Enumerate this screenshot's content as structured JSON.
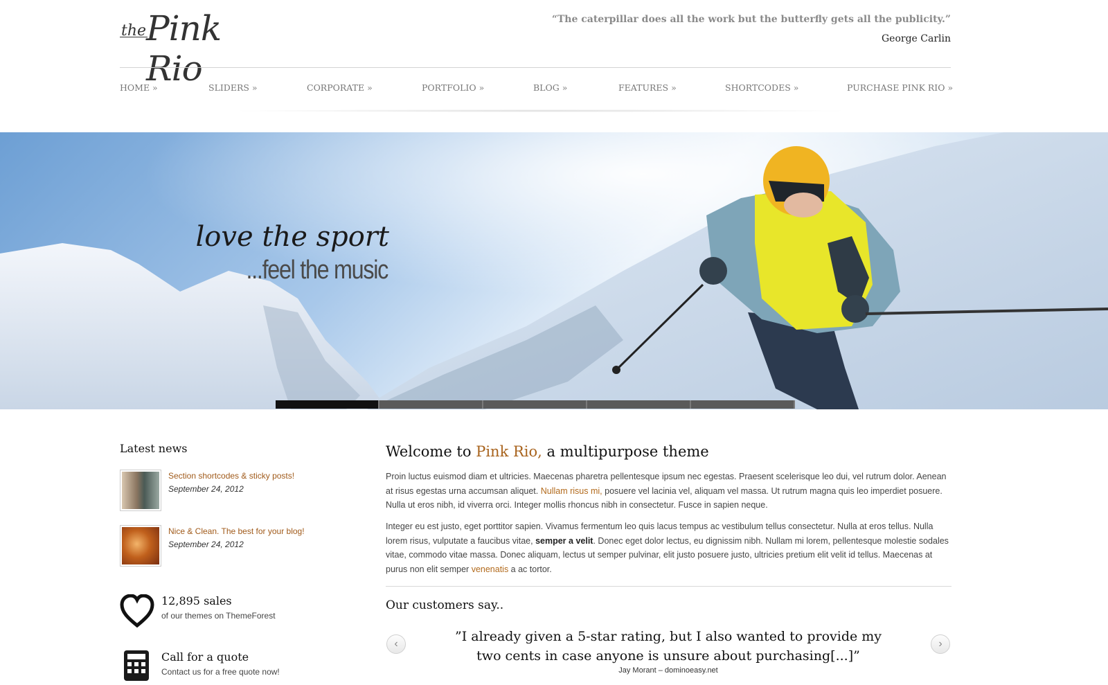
{
  "header": {
    "logo": {
      "prefix": "the",
      "name": "Pink Rio"
    },
    "quote": "“The caterpillar does all the work but the butterfly gets all the publicity.”",
    "quote_author": "George Carlin"
  },
  "nav": {
    "items": [
      {
        "label": "HOME »"
      },
      {
        "label": "SLIDERS »"
      },
      {
        "label": "CORPORATE »"
      },
      {
        "label": "PORTFOLIO »"
      },
      {
        "label": "BLOG »"
      },
      {
        "label": "FEATURES »"
      },
      {
        "label": "SHORTCODES »"
      },
      {
        "label": "PURCHASE PINK RIO »"
      }
    ]
  },
  "slider": {
    "title": "love the sport",
    "subtitle": "...feel the music",
    "slide_count": 5,
    "active_slide": 1
  },
  "latest_news": {
    "heading": "Latest news",
    "items": [
      {
        "title": "Section shortcodes & sticky posts!",
        "date": "September 24, 2012"
      },
      {
        "title": "Nice & Clean. The best for your blog!",
        "date": "September 24, 2012"
      }
    ]
  },
  "stats": [
    {
      "icon": "heart-icon",
      "title": "12,895 sales",
      "subtitle": "of our themes on ThemeForest"
    },
    {
      "icon": "calculator-icon",
      "title": "Call for a quote",
      "subtitle": "Contact us for a free quote now!"
    }
  ],
  "welcome": {
    "prefix": "Welcome to ",
    "accent": "Pink Rio,",
    "suffix": " a multipurpose theme",
    "p1_a": "Proin luctus euismod diam et ultricies. Maecenas pharetra pellentesque ipsum nec egestas. Praesent scelerisque leo dui, vel rutrum dolor. Aenean at risus egestas urna accumsan aliquet. ",
    "p1_link": "Nullam risus mi,",
    "p1_b": " posuere vel lacinia vel, aliquam vel massa. Ut rutrum magna quis leo imperdiet posuere. Nulla ut eros nibh, id viverra orci. Integer mollis rhoncus nibh in consectetur. Fusce in sapien neque.",
    "p2_a": "Integer eu est justo, eget porttitor sapien. Vivamus fermentum leo quis lacus tempus ac vestibulum tellus consectetur. Nulla at eros tellus. Nulla lorem risus, vulputate a faucibus vitae, ",
    "p2_bold": "semper a velit",
    "p2_b": ". Donec eget dolor lectus, eu dignissim nibh. Nullam mi lorem, pellentesque molestie sodales vitae, commodo vitae massa. Donec aliquam, lectus ut semper pulvinar, elit justo posuere justo, ultricies pretium elit velit id tellus. Maecenas at purus non elit semper ",
    "p2_link": "venenatis",
    "p2_c": " a ac tortor."
  },
  "customers": {
    "heading": "Our customers say..",
    "quote": "”I already given a 5-star rating, but I also wanted to provide my two cents in case anyone is unsure about purchasing[...]”",
    "author": "Jay Morant – dominoeasy.net",
    "prev_icon": "chevron-left-icon",
    "next_icon": "chevron-right-icon"
  },
  "colors": {
    "accent": "#a8631d",
    "link": "#b26a1c"
  }
}
